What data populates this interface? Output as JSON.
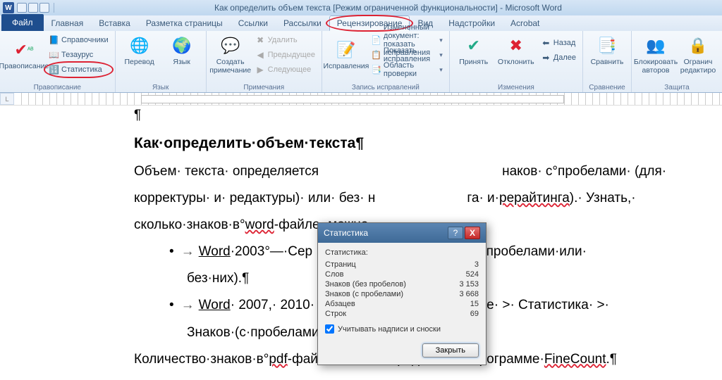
{
  "titlebar": {
    "title": "Как определить объем текста [Режим ограниченной функциональности] - Microsoft Word"
  },
  "tabs": {
    "file": "Файл",
    "home": "Главная",
    "insert": "Вставка",
    "layout": "Разметка страницы",
    "links": "Ссылки",
    "mail": "Рассылки",
    "review": "Рецензирование",
    "view": "Вид",
    "addins": "Надстройки",
    "acrobat": "Acrobat"
  },
  "ribbon": {
    "proofing": {
      "group": "Правописание",
      "spelling": "Правописание",
      "research": "Справочники",
      "thesaurus": "Тезаурус",
      "wordcount": "Статистика"
    },
    "language": {
      "group": "Язык",
      "translate": "Перевод",
      "language": "Язык"
    },
    "comments": {
      "group": "Примечания",
      "new": "Создать примечание",
      "delete": "Удалить",
      "prev": "Предыдущее",
      "next": "Следующее"
    },
    "tracking": {
      "group": "Запись исправлений",
      "track": "Исправления",
      "display": "Измененный документ: показать исправления",
      "show": "Показать исправления",
      "pane": "Область проверки"
    },
    "changes": {
      "group": "Изменения",
      "accept": "Принять",
      "reject": "Отклонить",
      "prev": "Назад",
      "next": "Далее"
    },
    "compare": {
      "group": "Сравнение",
      "compare": "Сравнить"
    },
    "protect": {
      "group": "Защита",
      "block": "Блокировать авторов",
      "restrict": "Огранич редактиро"
    }
  },
  "doc": {
    "heading": "Как·определить·объем·текста",
    "p1a": "Объем· текста· определяется",
    "p1b": "наков· с°пробелами· (для·",
    "p2a": "корректуры· и· редактуры)· или· без· н",
    "p2b": "га· и·",
    "p2link": "рерайтинга",
    "p2c": ").· Узнать,·",
    "p3": "сколько·знаков·в°",
    "p3link": "word",
    "p3b": "-файле,·можно·",
    "b1a": "Word",
    "b1b": "·2003°—·Сер",
    "b1c": "·Знаков·(с·пробелами·или·",
    "b1d": "без·них).",
    "b2a": "Word",
    "b2b": "· 2007,· 2010· и· 2013°—· Рецензирование· >· Статистика· >·",
    "b2c": "Знаков·(с·пробелами·или·без·них).",
    "p4a": "Количество·знаков·в°",
    "p4link": "pdf",
    "p4b": "-файле·можно·определить·в°программе·",
    "p4link2": "FineCount",
    "p4c": "."
  },
  "dialog": {
    "title": "Статистика",
    "section": "Статистика:",
    "rows": [
      {
        "label": "Страниц",
        "value": "3"
      },
      {
        "label": "Слов",
        "value": "524"
      },
      {
        "label": "Знаков (без пробелов)",
        "value": "3 153"
      },
      {
        "label": "Знаков (с пробелами)",
        "value": "3 668"
      },
      {
        "label": "Абзацев",
        "value": "15"
      },
      {
        "label": "Строк",
        "value": "69"
      }
    ],
    "checkbox": "Учитывать надписи и сноски",
    "close": "Закрыть"
  }
}
